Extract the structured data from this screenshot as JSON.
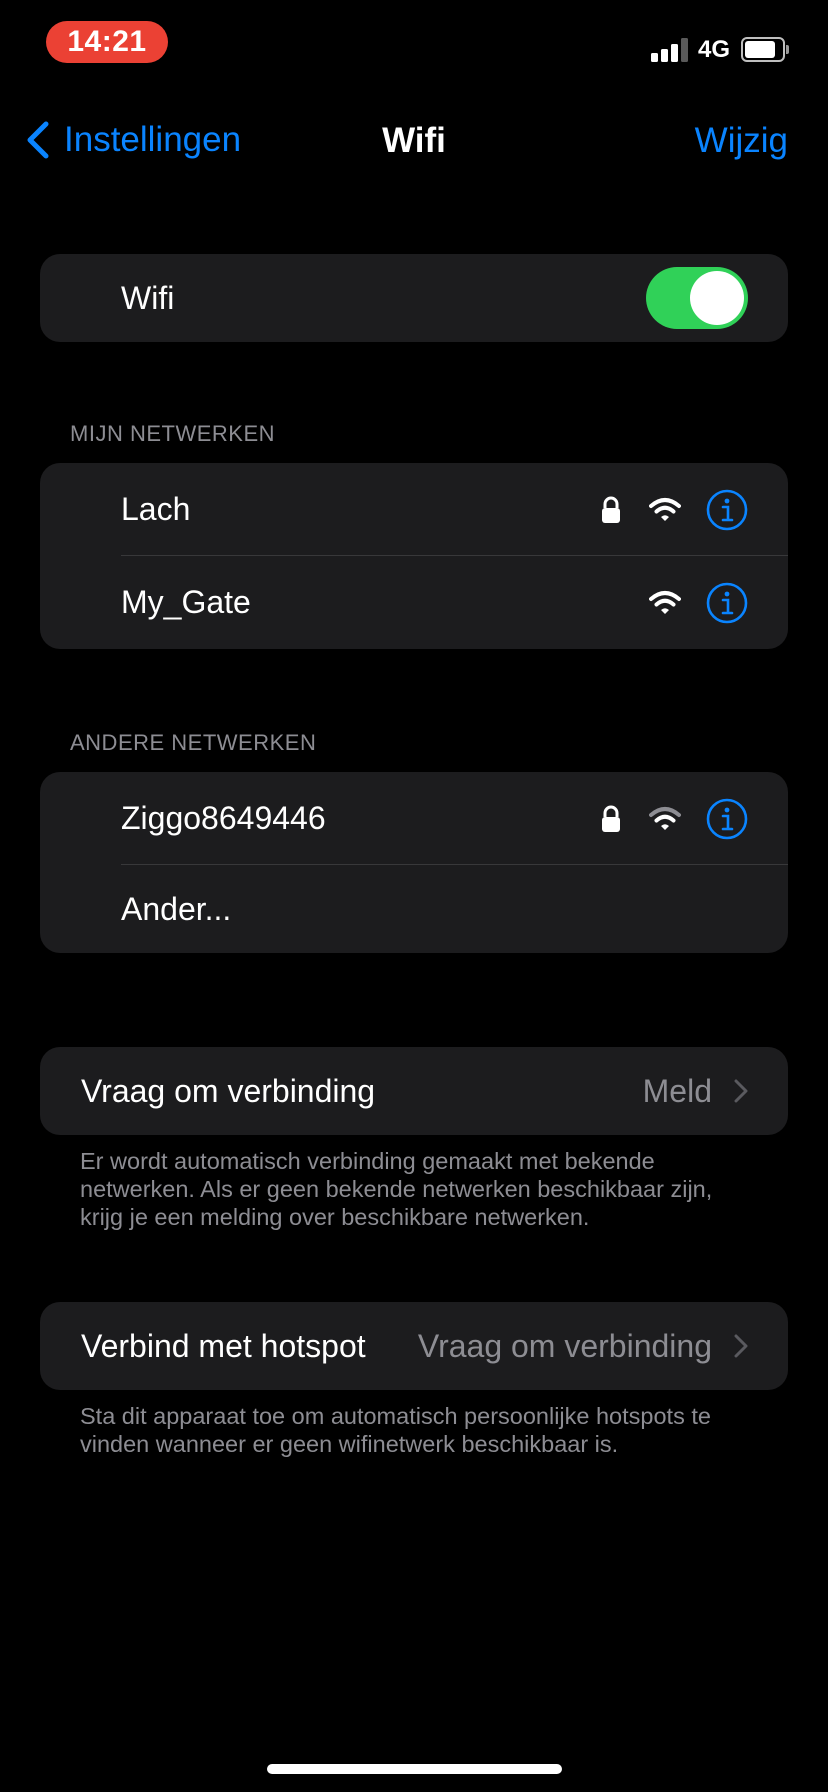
{
  "status_bar": {
    "time": "14:21",
    "network": "4G"
  },
  "nav": {
    "back_label": "Instellingen",
    "title": "Wifi",
    "edit_label": "Wijzig"
  },
  "wifi_toggle": {
    "label": "Wifi",
    "on": true,
    "on_color": "#30d158"
  },
  "my_networks": {
    "header": "MIJN NETWERKEN",
    "items": [
      {
        "name": "Lach",
        "secured": true
      },
      {
        "name": "My_Gate",
        "secured": false
      }
    ]
  },
  "other_networks": {
    "header": "ANDERE NETWERKEN",
    "items": [
      {
        "name": "Ziggo8649446",
        "secured": true
      },
      {
        "name": "Ander..."
      }
    ]
  },
  "ask_to_join": {
    "label": "Vraag om verbinding",
    "value": "Meld",
    "footer": "Er wordt automatisch verbinding gemaakt met bekende netwerken. Als er geen bekende netwerken beschikbaar zijn, krijg je een melding over beschikbare netwerken."
  },
  "hotspot": {
    "label": "Verbind met hotspot",
    "value": "Vraag om verbinding",
    "footer": "Sta dit apparaat toe om automatisch persoonlijke hotspots te vinden wanneer er geen wifinetwerk beschikbaar is."
  },
  "colors": {
    "accent": "#0a84ff",
    "background": "#000000",
    "cell": "#1c1c1e",
    "time_pill": "#eb4134"
  }
}
